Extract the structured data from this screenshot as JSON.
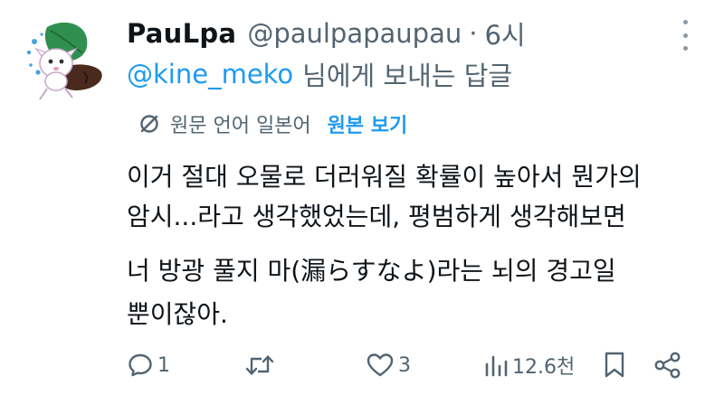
{
  "tweet": {
    "display_name": "PauLpa",
    "handle": "@paulpapaupau",
    "separator": "·",
    "time": "6시",
    "reply_mention": "@kine_meko",
    "reply_suffix": "님에게 보내는 답글",
    "translation": {
      "label": "원문 언어 일본어",
      "show_original": "원본 보기"
    },
    "body_lines": [
      "이거 절대 오물로 더러워질 확률이 높아서 뭔가의",
      "암시...라고 생각했었는데, 평범하게 생각해보면",
      "너 방광 풀지 마(漏らすなよ)라는 뇌의 경고일",
      "뿐이잖아."
    ]
  },
  "actions": {
    "reply": {
      "icon": "reply-icon",
      "count": "1"
    },
    "retweet": {
      "icon": "retweet-icon",
      "count": ""
    },
    "like": {
      "icon": "heart-icon",
      "count": "3"
    },
    "views": {
      "icon": "views-icon",
      "count": "12.6천"
    },
    "bookmark": {
      "icon": "bookmark-icon"
    },
    "share": {
      "icon": "share-icon"
    }
  },
  "colors": {
    "accent": "#1d9bf0",
    "secondary_text": "#536471",
    "primary_text": "#0f1419",
    "avatar_leaf": "#2f8f4e"
  }
}
